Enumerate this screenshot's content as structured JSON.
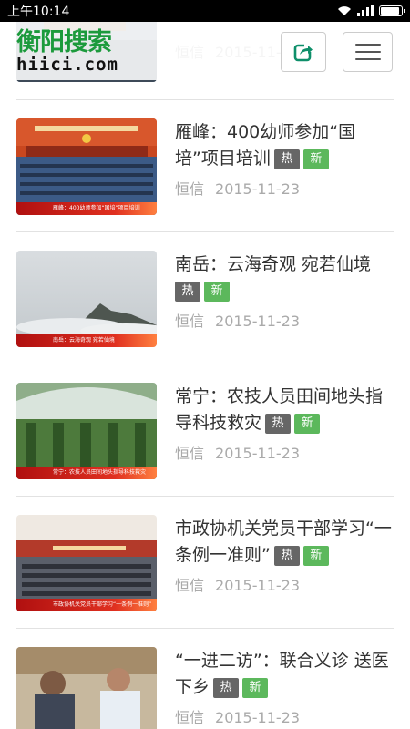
{
  "status_bar": {
    "time": "上午10:14"
  },
  "header": {
    "logo_top": "衡阳搜索",
    "logo_bottom": "hiici.com",
    "colors": {
      "logo_green": "#1c9a3c"
    }
  },
  "tags": {
    "hot": "热",
    "new": "新",
    "hot_color": "#666666",
    "new_color": "#5cb85c"
  },
  "articles": [
    {
      "title": "",
      "source": "恒信",
      "date": "2015-11-23"
    },
    {
      "title": "雁峰：400幼师参加“国培”项目培训",
      "source": "恒信",
      "date": "2015-11-23",
      "caption": "雁峰：400幼师参加“国培”项目培训"
    },
    {
      "title": "南岳：云海奇观 宛若仙境",
      "source": "恒信",
      "date": "2015-11-23",
      "caption": "南岳：云海奇观 宛若仙境"
    },
    {
      "title": "常宁：农技人员田间地头指导科技救灾",
      "source": "恒信",
      "date": "2015-11-23",
      "caption": "常宁：农技人员田间地头指导科技救灾"
    },
    {
      "title": "市政协机关党员干部学习“一条例一准则”",
      "source": "恒信",
      "date": "2015-11-23",
      "caption": "市政协机关党员干部学习“一条例一准则”"
    },
    {
      "title": "“一进二访”：联合义诊 送医下乡",
      "source": "恒信",
      "date": "2015-11-23"
    }
  ]
}
